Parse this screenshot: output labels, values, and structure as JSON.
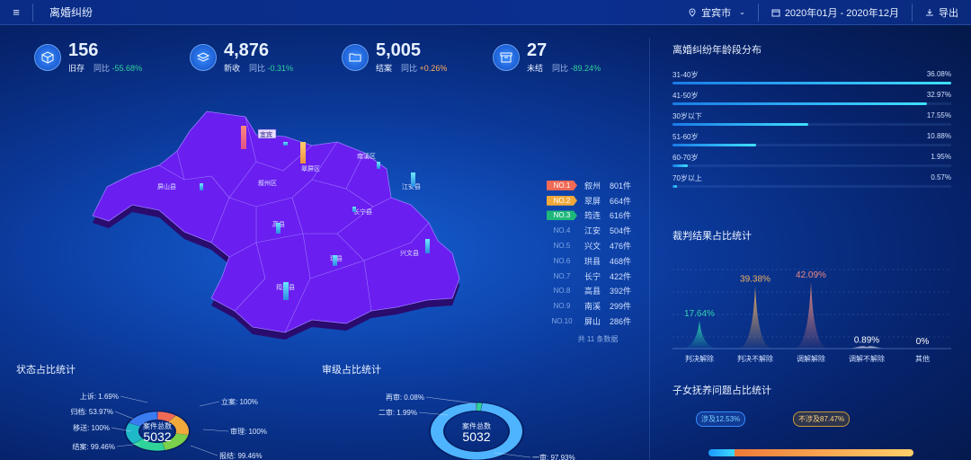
{
  "header": {
    "title": "离婚纠纷",
    "city": "宜宾市",
    "date_range": "2020年01月 - 2020年12月",
    "export": "导出"
  },
  "kpis": [
    {
      "value": "156",
      "label": "旧存",
      "cmp_label": "同比",
      "cmp": "-55.68%",
      "trend": "down"
    },
    {
      "value": "4,876",
      "label": "新收",
      "cmp_label": "同比",
      "cmp": "-0.31%",
      "trend": "down"
    },
    {
      "value": "5,005",
      "label": "结案",
      "cmp_label": "同比",
      "cmp": "+0.26%",
      "trend": "up"
    },
    {
      "value": "27",
      "label": "未结",
      "cmp_label": "同比",
      "cmp": "-89.24%",
      "trend": "down"
    }
  ],
  "map": {
    "labels": [
      "屏山县",
      "叙州区",
      "翠屏区",
      "南溪区",
      "江安县",
      "长宁县",
      "高县",
      "珙县",
      "兴文县",
      "筠连县"
    ],
    "highlight_label": "宜宾"
  },
  "ranking": {
    "rows": [
      {
        "no": "NO.1",
        "name": "叙州",
        "count": "801件",
        "badge": "#f06a55"
      },
      {
        "no": "NO.2",
        "name": "翠屏",
        "count": "664件",
        "badge": "#f0a93a"
      },
      {
        "no": "NO.3",
        "name": "筠连",
        "count": "616件",
        "badge": "#1eb87a"
      },
      {
        "no": "NO.4",
        "name": "江安",
        "count": "504件"
      },
      {
        "no": "NO.5",
        "name": "兴文",
        "count": "476件"
      },
      {
        "no": "NO.6",
        "name": "珙县",
        "count": "468件"
      },
      {
        "no": "NO.7",
        "name": "长宁",
        "count": "422件"
      },
      {
        "no": "NO.8",
        "name": "高县",
        "count": "392件"
      },
      {
        "no": "NO.9",
        "name": "南溪",
        "count": "299件"
      },
      {
        "no": "NO.10",
        "name": "屏山",
        "count": "286件"
      }
    ],
    "total": "共 11 条数据"
  },
  "age_section": {
    "title": "离婚纠纷年龄段分布",
    "rows": [
      {
        "label": "31-40岁",
        "pct": "36.08%",
        "value": 36.08
      },
      {
        "label": "41-50岁",
        "pct": "32.97%",
        "value": 32.97
      },
      {
        "label": "30岁以下",
        "pct": "17.55%",
        "value": 17.55
      },
      {
        "label": "51-60岁",
        "pct": "10.88%",
        "value": 10.88
      },
      {
        "label": "60-70岁",
        "pct": "1.95%",
        "value": 1.95
      },
      {
        "label": "70岁以上",
        "pct": "0.57%",
        "value": 0.57
      }
    ]
  },
  "judge_section": {
    "title": "裁判结果占比统计",
    "chart_data": {
      "type": "area",
      "categories": [
        "判决解除",
        "判决不解除",
        "调解解除",
        "调解不解除",
        "其他"
      ],
      "values": [
        17.64,
        39.38,
        42.09,
        0.89,
        0
      ],
      "labels": [
        "17.64%",
        "39.38%",
        "42.09%",
        "0.89%",
        "0%"
      ],
      "colors": [
        "#2fd3b0",
        "#f0b060",
        "#f08a80",
        "#ffffff",
        "#ffffff"
      ],
      "ylim": [
        0,
        50
      ]
    }
  },
  "child_section": {
    "title": "子女抚养问题占比统计",
    "involved": "涉及12.53%",
    "not_involved": "不涉及87.47%",
    "involved_value": 12.53,
    "not_involved_value": 87.47
  },
  "status_section": {
    "title": "状态占比统计",
    "center_label": "案件总数",
    "center_value": "5032",
    "chart_data": {
      "type": "pie",
      "labels": [
        "上诉: 1.69%",
        "归档: 53.97%",
        "移送: 100%",
        "结案: 99.46%",
        "立案: 100%",
        "审理: 100%",
        "报结: 99.46%"
      ],
      "values": [
        1.69,
        53.97,
        100,
        99.46,
        100,
        100,
        99.46
      ],
      "colors": [
        "#c75cf0",
        "#f06a55",
        "#f0a93a",
        "#7ad04a",
        "#2fd39a",
        "#1eb8c8",
        "#3a7cf0"
      ]
    }
  },
  "level_section": {
    "title": "审级占比统计",
    "center_label": "案件总数",
    "center_value": "5032",
    "chart_data": {
      "type": "pie",
      "labels": [
        "再审: 0.08%",
        "二审: 1.99%",
        "一审: 97.93%"
      ],
      "values": [
        0.08,
        1.99,
        97.93
      ],
      "colors": [
        "#f0a93a",
        "#2fd39a",
        "#4fb4ff"
      ]
    }
  }
}
